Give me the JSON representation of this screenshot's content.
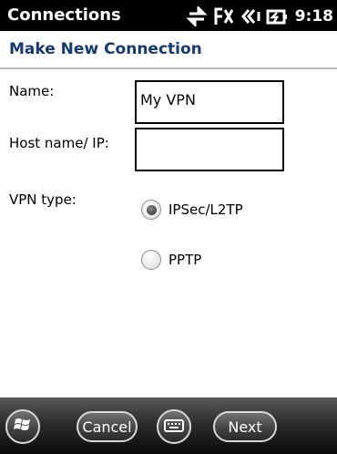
{
  "status_bar": {
    "title": "Connections",
    "time": "9:18",
    "icons": [
      "data-transfer-icon",
      "no-signal-icon",
      "volume-icon",
      "battery-charging-icon"
    ]
  },
  "header": {
    "title": "Make New Connection"
  },
  "form": {
    "name_label": "Name:",
    "name_value": "My VPN",
    "host_label": "Host name/ IP:",
    "host_value": "",
    "vpn_type_label": "VPN type:",
    "vpn_options": [
      {
        "label": "IPSec/L2TP",
        "selected": true
      },
      {
        "label": "PPTP",
        "selected": false
      }
    ]
  },
  "bottom_bar": {
    "start_icon": "windows-flag-icon",
    "cancel_label": "Cancel",
    "keyboard_icon": "keyboard-icon",
    "next_label": "Next"
  }
}
